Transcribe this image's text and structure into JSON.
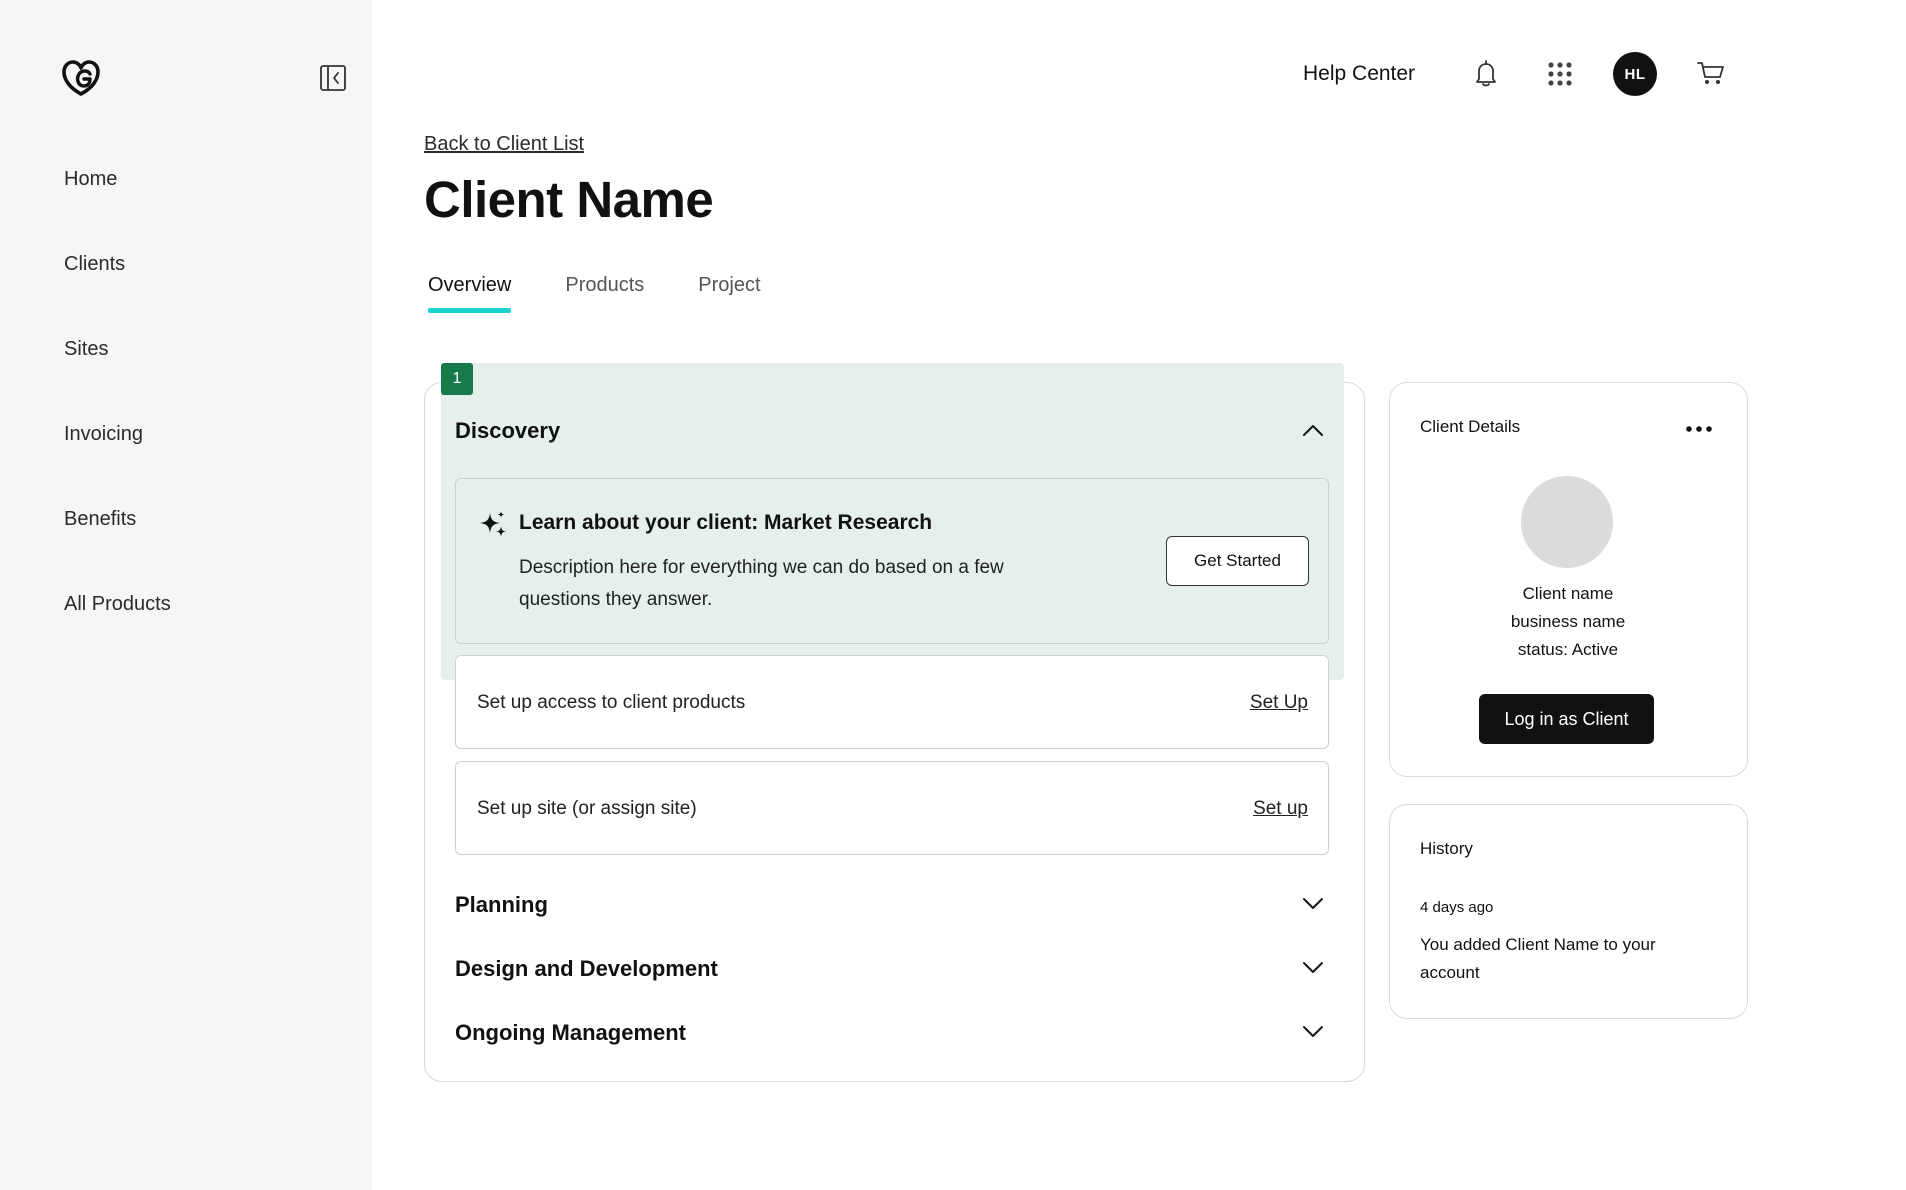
{
  "sidebar": {
    "logo_icon": "godaddy-logo-icon",
    "collapse_icon": "collapse-sidebar-icon",
    "items": [
      {
        "label": "Home"
      },
      {
        "label": "Clients"
      },
      {
        "label": "Sites"
      },
      {
        "label": "Invoicing"
      },
      {
        "label": "Benefits"
      },
      {
        "label": "All Products"
      }
    ]
  },
  "header": {
    "help_center": "Help Center",
    "bell_icon": "bell-icon",
    "apps_icon": "apps-grid-icon",
    "avatar_initials": "HL",
    "cart_icon": "cart-icon"
  },
  "page": {
    "back_link": "Back to Client List",
    "title": "Client Name",
    "tabs": [
      {
        "label": "Overview",
        "active": true
      },
      {
        "label": "Products",
        "active": false
      },
      {
        "label": "Project",
        "active": false
      }
    ]
  },
  "main": {
    "step_number": "1",
    "sections": [
      {
        "title": "Discovery",
        "expanded": true
      },
      {
        "title": "Planning",
        "expanded": false
      },
      {
        "title": "Design and Development",
        "expanded": false
      },
      {
        "title": "Ongoing Management",
        "expanded": false
      }
    ],
    "research": {
      "icon": "sparkle-icon",
      "title": "Learn about your client: Market Research",
      "description": "Description here for everything we can do based on a few questions they answer.",
      "button": "Get Started"
    },
    "tasks": [
      {
        "label": "Set up access to client products",
        "link": "Set Up"
      },
      {
        "label": "Set up site (or assign site)",
        "link": "Set up"
      }
    ]
  },
  "client_details": {
    "title": "Client Details",
    "more_icon": "more-horizontal-icon",
    "lines": [
      "Client name",
      "business name",
      "status: Active"
    ],
    "login_button": "Log in as Client"
  },
  "history": {
    "title": "History",
    "time": "4 days ago",
    "text": "You added Client Name to your account"
  },
  "colors": {
    "accent_tab_underline": "#1bd3cf",
    "highlight_bg": "#e6f0eb",
    "step_badge": "#167a4a",
    "sidebar_bg": "#f5f6f8"
  }
}
